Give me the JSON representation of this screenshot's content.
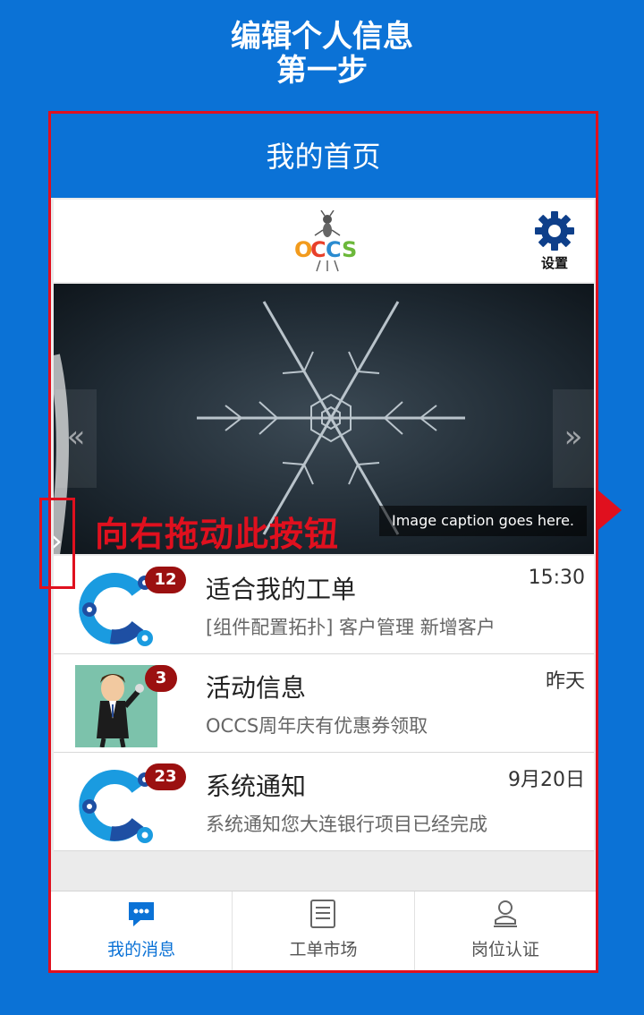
{
  "guide": {
    "title_line1": "编辑个人信息",
    "title_line2": "第一步",
    "drag_hint": "向右拖动此按钮",
    "accent_color": "#e0101e"
  },
  "app": {
    "title": "我的首页",
    "brand_color": "#0b72d6",
    "logo_text": "OCCS",
    "settings_label": "设置"
  },
  "carousel": {
    "caption": "Image caption goes here.",
    "prev_icon": "«",
    "next_icon": "»"
  },
  "messages": [
    {
      "title": "适合我的工单",
      "subtitle": "[组件配置拓扑] 客户管理 新增客户",
      "time": "15:30",
      "badge": "12",
      "icon": "gears-icon"
    },
    {
      "title": "活动信息",
      "subtitle": "OCCS周年庆有优惠券领取",
      "time": "昨天",
      "badge": "3",
      "icon": "cartoon-businessman-icon"
    },
    {
      "title": "系统通知",
      "subtitle": "系统通知您大连银行项目已经完成",
      "time": "9月20日",
      "badge": "23",
      "icon": "gears-icon"
    }
  ],
  "tabs": [
    {
      "label": "我的消息",
      "icon": "chat-bubble-icon",
      "active": true
    },
    {
      "label": "工单市场",
      "icon": "document-list-icon",
      "active": false
    },
    {
      "label": "岗位认证",
      "icon": "user-badge-icon",
      "active": false
    }
  ]
}
